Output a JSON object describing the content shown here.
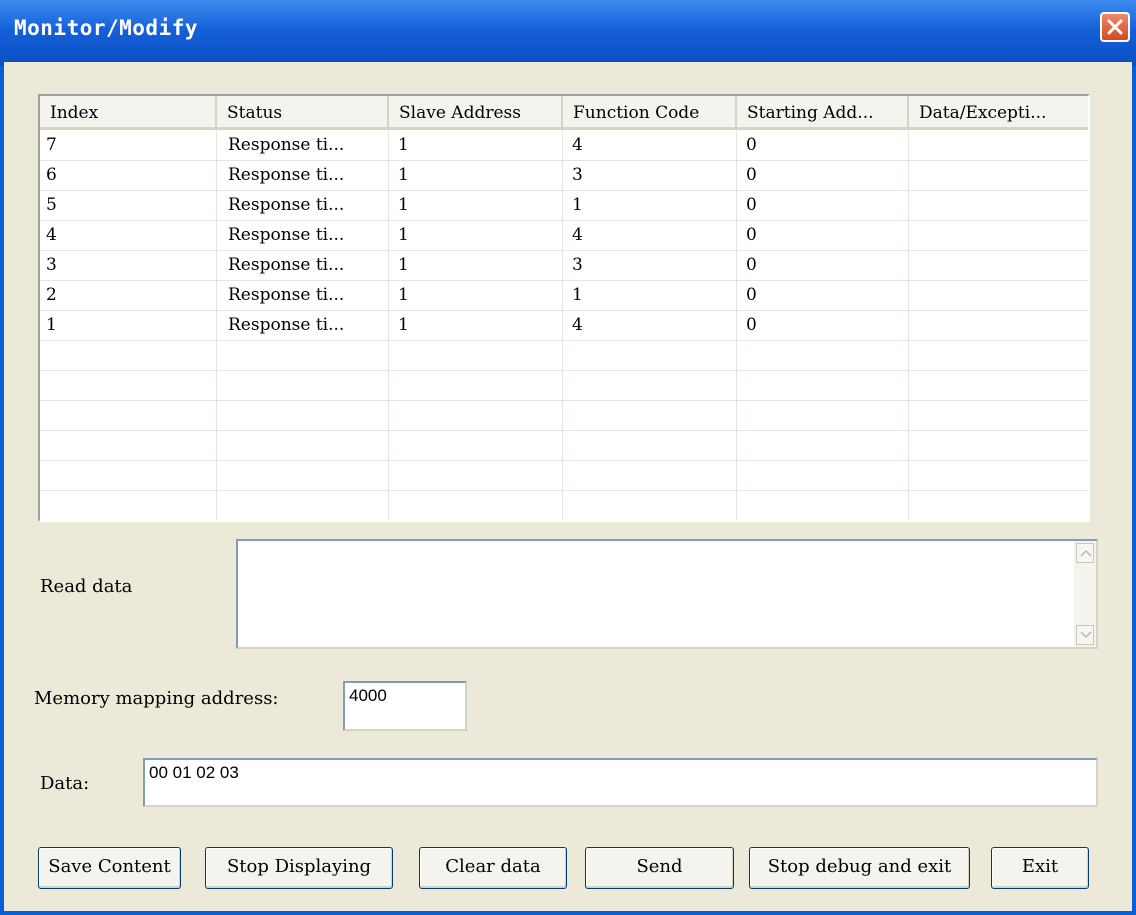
{
  "window": {
    "title": "Monitor/Modify"
  },
  "table": {
    "columns": [
      "Index",
      "Status",
      "Slave Address",
      "Function Code",
      "Starting Add...",
      "Data/Excepti..."
    ],
    "rows": [
      [
        "7",
        "Response ti...",
        "1",
        "4",
        "0",
        ""
      ],
      [
        "6",
        "Response ti...",
        "1",
        "3",
        "0",
        ""
      ],
      [
        "5",
        "Response ti...",
        "1",
        "1",
        "0",
        ""
      ],
      [
        "4",
        "Response ti...",
        "1",
        "4",
        "0",
        ""
      ],
      [
        "3",
        "Response ti...",
        "1",
        "3",
        "0",
        ""
      ],
      [
        "2",
        "Response ti...",
        "1",
        "1",
        "0",
        ""
      ],
      [
        "1",
        "Response ti...",
        "1",
        "4",
        "0",
        ""
      ]
    ]
  },
  "read_data": {
    "label": "Read data",
    "value": ""
  },
  "memory": {
    "label": "Memory mapping address:",
    "value": "4000"
  },
  "data_field": {
    "label": "Data:",
    "value": "00 01 02 03"
  },
  "buttons": {
    "save": "Save Content",
    "stop_display": "Stop Displaying",
    "clear": "Clear data",
    "send": "Send",
    "stop_debug": "Stop debug and exit",
    "exit": "Exit"
  },
  "colors": {
    "title_bar": "#1560d8",
    "dialog_bg": "#ece9d8",
    "close_button": "#d24a22"
  },
  "icons": {
    "close": "close-icon",
    "scroll_up": "scroll-up-icon",
    "scroll_down": "scroll-down-icon"
  }
}
